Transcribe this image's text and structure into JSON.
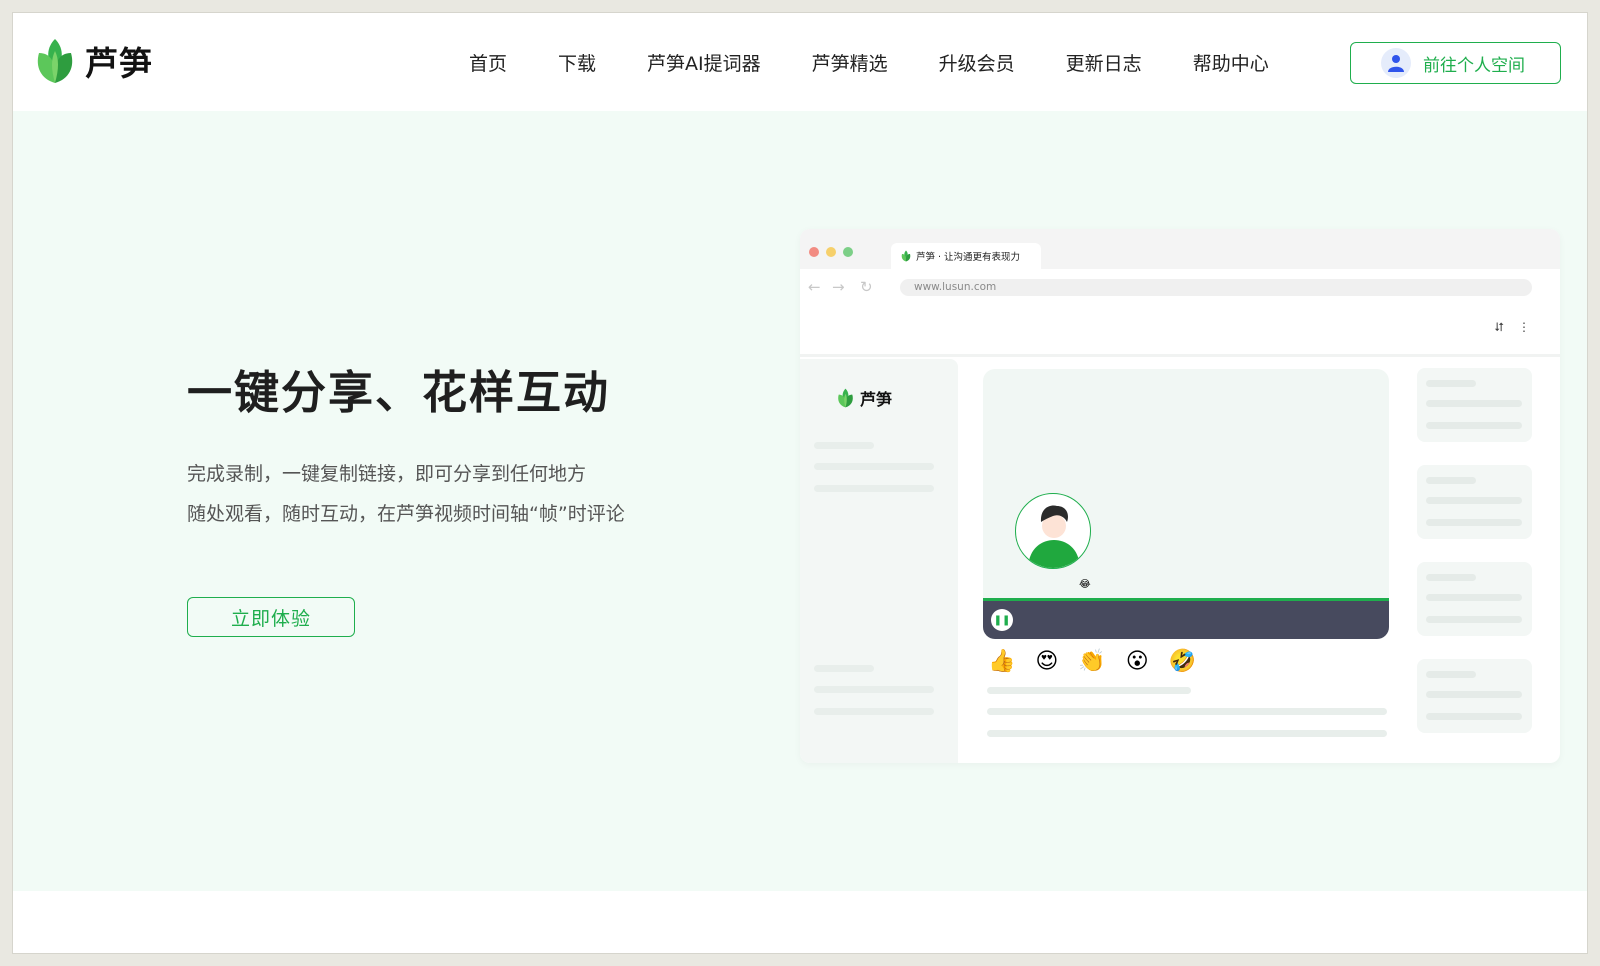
{
  "header": {
    "brand": "芦笋",
    "nav": [
      "首页",
      "下载",
      "芦笋AI提词器",
      "芦笋精选",
      "升级会员",
      "更新日志",
      "帮助中心"
    ],
    "space_button": "前往个人空间"
  },
  "hero": {
    "title": "一键分享、花样互动",
    "desc_line1": "完成录制，一键复制链接，即可分享到任何地方",
    "desc_line2": "随处观看，随时互动，在芦笋视频时间轴“帧”时评论",
    "cta": "立即体验"
  },
  "mockup": {
    "tab_title": "芦笋 · 让沟通更有表现力",
    "url": "www.lusun.com",
    "side_brand": "芦笋",
    "reactions": [
      "👍",
      "😍",
      "👏",
      "😮",
      "🤣"
    ],
    "mini_reaction": "😂"
  },
  "colors": {
    "accent": "#1fae4d",
    "hero_bg": "#f2fbf6",
    "player_bar": "#474a5e"
  }
}
